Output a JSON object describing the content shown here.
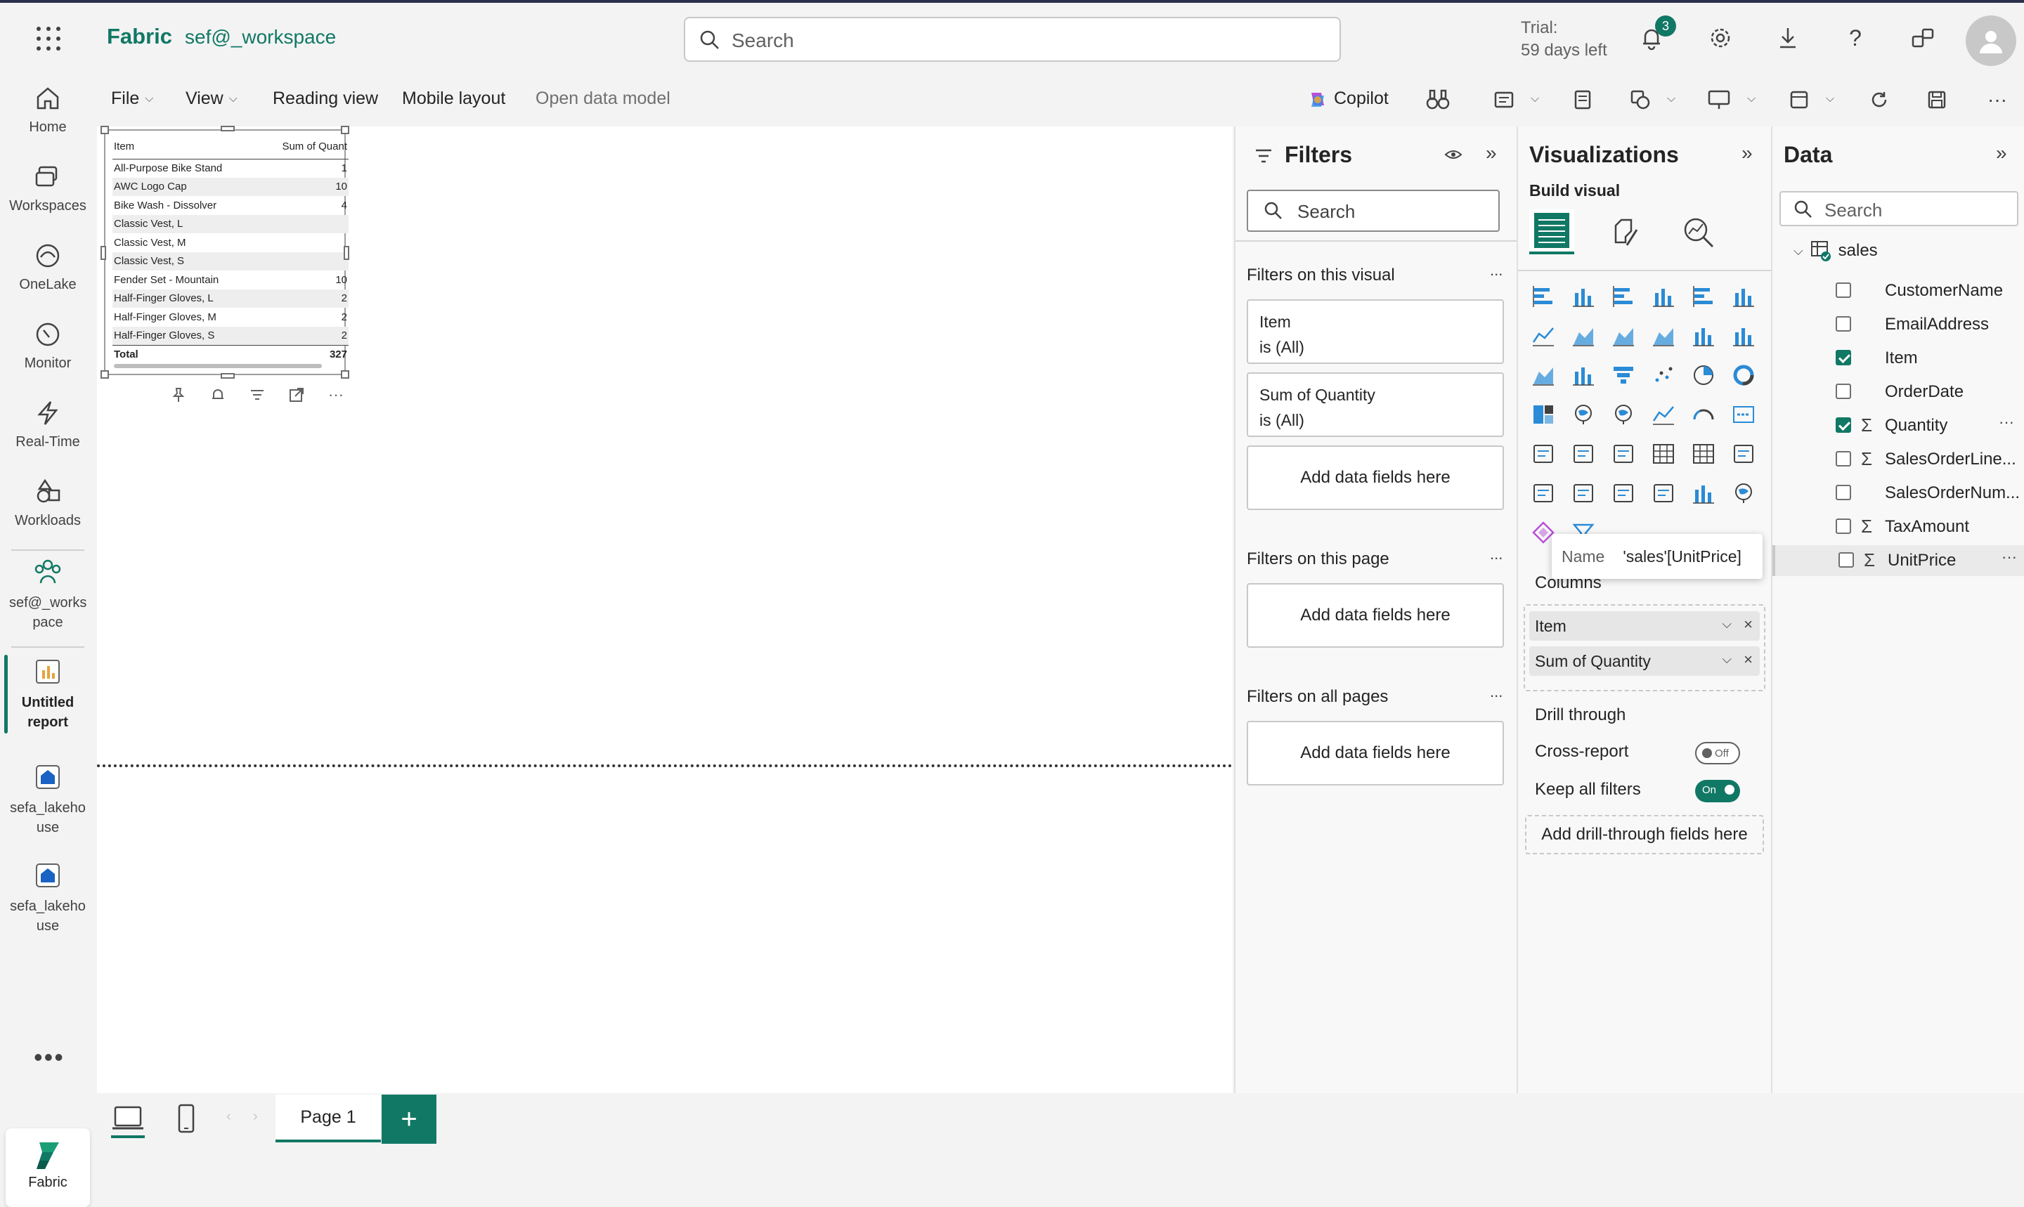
{
  "topbar": {
    "brand": "Fabric",
    "workspace": "sef@_workspace",
    "search_placeholder": "Search",
    "trial_line1": "Trial:",
    "trial_line2": "59 days left",
    "notification_count": "3"
  },
  "leftnav": {
    "items": [
      {
        "label": "Home",
        "icon": "home-icon"
      },
      {
        "label": "Workspaces",
        "icon": "workspaces-icon"
      },
      {
        "label": "OneLake",
        "icon": "onelake-icon"
      },
      {
        "label": "Monitor",
        "icon": "monitor-icon"
      },
      {
        "label": "Real-Time",
        "icon": "lightning-icon"
      },
      {
        "label": "Workloads",
        "icon": "workloads-icon"
      },
      {
        "label": "sef@_works pace",
        "icon": "workspace-people-icon"
      },
      {
        "label": "Untitled report",
        "icon": "report-icon"
      },
      {
        "label": "sefa_lakeho use",
        "icon": "lakehouse-icon"
      },
      {
        "label": "sefa_lakeho use",
        "icon": "lakehouse-icon"
      }
    ],
    "more": "•••",
    "bottom_label": "Fabric"
  },
  "ribbon": {
    "file": "File",
    "view": "View",
    "reading_view": "Reading view",
    "mobile_layout": "Mobile layout",
    "open_data_model": "Open data model",
    "copilot": "Copilot"
  },
  "table_visual": {
    "headers": [
      "Item",
      "Sum of Quant"
    ],
    "rows": [
      {
        "item": "All-Purpose Bike Stand",
        "qty": "1"
      },
      {
        "item": "AWC Logo Cap",
        "qty": "10"
      },
      {
        "item": "Bike Wash - Dissolver",
        "qty": "4"
      },
      {
        "item": "Classic Vest, L",
        "qty": ""
      },
      {
        "item": "Classic Vest, M",
        "qty": ""
      },
      {
        "item": "Classic Vest, S",
        "qty": ""
      },
      {
        "item": "Fender Set - Mountain",
        "qty": "10"
      },
      {
        "item": "Half-Finger Gloves, L",
        "qty": "2"
      },
      {
        "item": "Half-Finger Gloves, M",
        "qty": "2"
      },
      {
        "item": "Half-Finger Gloves, S",
        "qty": "2"
      }
    ],
    "total_label": "Total",
    "total_value": "327"
  },
  "pages": {
    "tab": "Page 1",
    "add": "+"
  },
  "filters": {
    "title": "Filters",
    "search_placeholder": "Search",
    "on_visual": "Filters on this visual",
    "on_page": "Filters on this page",
    "on_all_pages": "Filters on all pages",
    "cards": [
      {
        "name": "Item",
        "state": "is (All)"
      },
      {
        "name": "Sum of Quantity",
        "state": "is (All)"
      }
    ],
    "add_fields": "Add data fields here",
    "more": "..."
  },
  "visualizations": {
    "title": "Visualizations",
    "build_visual": "Build visual",
    "columns_label": "Columns",
    "wells": [
      "Item",
      "Sum of Quantity"
    ],
    "drill_through": "Drill through",
    "cross_report": "Cross-report",
    "cross_report_state": "Off",
    "keep_all_filters": "Keep all filters",
    "keep_all_filters_state": "On",
    "add_drill": "Add drill-through fields here",
    "more_visuals": "...",
    "tooltip_key": "Name",
    "tooltip_value": "'sales'[UnitPrice]"
  },
  "data": {
    "title": "Data",
    "search_placeholder": "Search",
    "table": "sales",
    "fields": [
      {
        "name": "CustomerName",
        "checked": false,
        "sigma": false
      },
      {
        "name": "EmailAddress",
        "checked": false,
        "sigma": false
      },
      {
        "name": "Item",
        "checked": true,
        "sigma": false
      },
      {
        "name": "OrderDate",
        "checked": false,
        "sigma": false
      },
      {
        "name": "Quantity",
        "checked": true,
        "sigma": true
      },
      {
        "name": "SalesOrderLine...",
        "checked": false,
        "sigma": true
      },
      {
        "name": "SalesOrderNum...",
        "checked": false,
        "sigma": false
      },
      {
        "name": "TaxAmount",
        "checked": false,
        "sigma": true
      },
      {
        "name": "UnitPrice",
        "checked": false,
        "sigma": true
      }
    ]
  },
  "colors": {
    "accent": "#117865",
    "brand_bar": "#2b2f4c"
  }
}
